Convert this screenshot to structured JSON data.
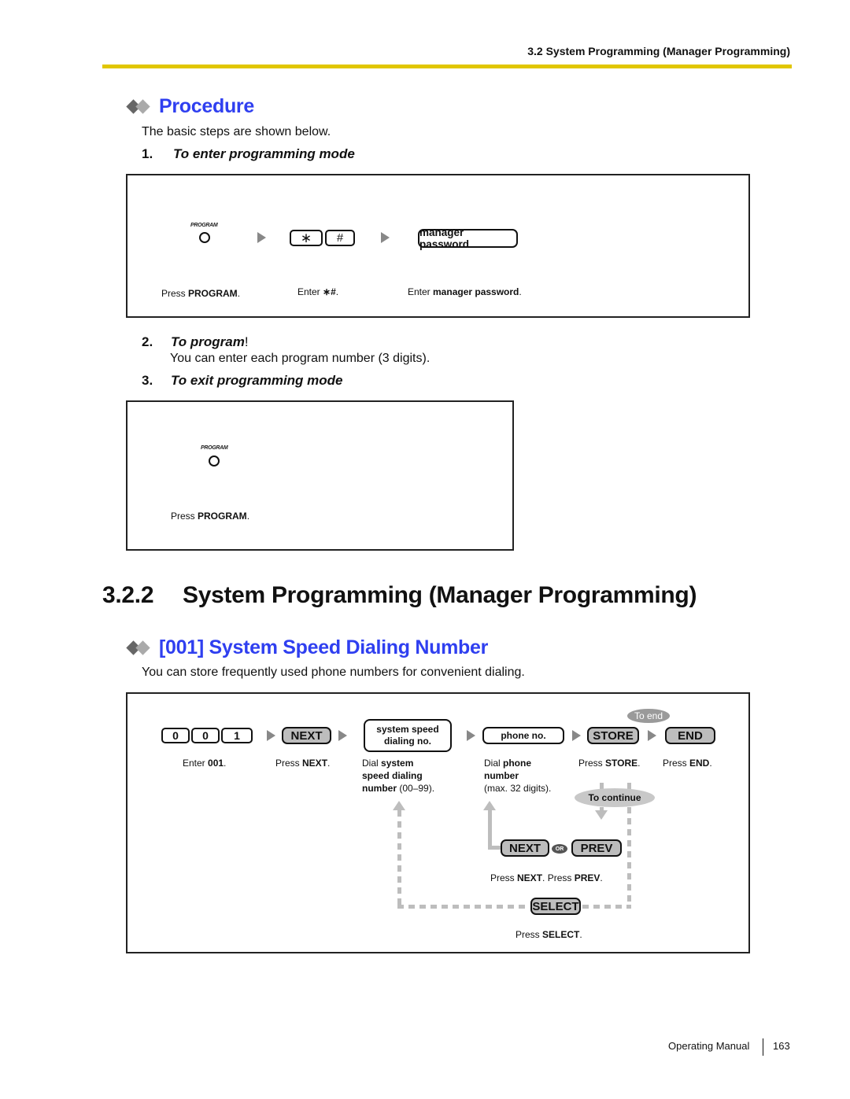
{
  "header": {
    "running_head": "3.2 System Programming (Manager Programming)",
    "rule_color": "#e1c600"
  },
  "procedure": {
    "title": "Procedure",
    "intro": "The basic steps are shown below.",
    "steps": [
      {
        "num": "1.",
        "title": "To enter programming mode",
        "flow": {
          "program_key_label": "PROGRAM",
          "keys": [
            "∗",
            "#"
          ],
          "password_key": "manager password",
          "captions": [
            {
              "prefix": "Press ",
              "bold": "PROGRAM",
              "suffix": "."
            },
            {
              "prefix": "Enter ",
              "bold": "∗#",
              "suffix": "."
            },
            {
              "prefix": "Enter ",
              "bold": "manager password",
              "suffix": "."
            }
          ]
        }
      },
      {
        "num": "2.",
        "title": "To program",
        "title_suffix": "!",
        "desc": "You can enter each program number (3 digits)."
      },
      {
        "num": "3.",
        "title": "To exit programming mode",
        "flow": {
          "program_key_label": "PROGRAM",
          "captions": [
            {
              "prefix": "Press ",
              "bold": "PROGRAM",
              "suffix": "."
            }
          ]
        }
      }
    ]
  },
  "section": {
    "number": "3.2.2",
    "title": "System Programming (Manager Programming)"
  },
  "subsection": {
    "title": "[001] System Speed Dialing Number",
    "desc": "You can store frequently used phone numbers for convenient dialing.",
    "accent_color": "#2f3ff0",
    "flow": {
      "digit_keys": [
        "0",
        "0",
        "1"
      ],
      "next_key": "NEXT",
      "system_speed_key": [
        "system speed",
        "dialing no."
      ],
      "phone_key": "phone no.",
      "store_key": "STORE",
      "end_key": "END",
      "to_end": "To end",
      "to_continue": "To continue",
      "next2_key": "NEXT",
      "or_label": "OR",
      "prev_key": "PREV",
      "select_key": "SELECT",
      "captions": {
        "enter": {
          "prefix": "Enter ",
          "bold": "001",
          "suffix": "."
        },
        "press_next": {
          "prefix": "Press ",
          "bold": "NEXT",
          "suffix": "."
        },
        "dial_system": {
          "line1_prefix": "Dial ",
          "line1_bold": "system",
          "line2_bold": "speed dialing",
          "line3_bold": "number",
          "line3_suffix": " (00–99)."
        },
        "dial_phone": {
          "line1_prefix": "Dial ",
          "line1_bold": "phone",
          "line2_bold": "number",
          "line3": "(max. 32 digits)."
        },
        "press_store": {
          "prefix": "Press ",
          "bold": "STORE",
          "suffix": "."
        },
        "press_end": {
          "prefix": "Press ",
          "bold": "END",
          "suffix": "."
        },
        "press_next2": {
          "prefix": "Press ",
          "bold": "NEXT",
          "suffix": "."
        },
        "press_prev": {
          "prefix": "Press ",
          "bold": "PREV",
          "suffix": "."
        },
        "press_select": {
          "prefix": "Press ",
          "bold": "SELECT",
          "suffix": "."
        }
      }
    }
  },
  "footer": {
    "manual": "Operating Manual",
    "page": "163"
  }
}
